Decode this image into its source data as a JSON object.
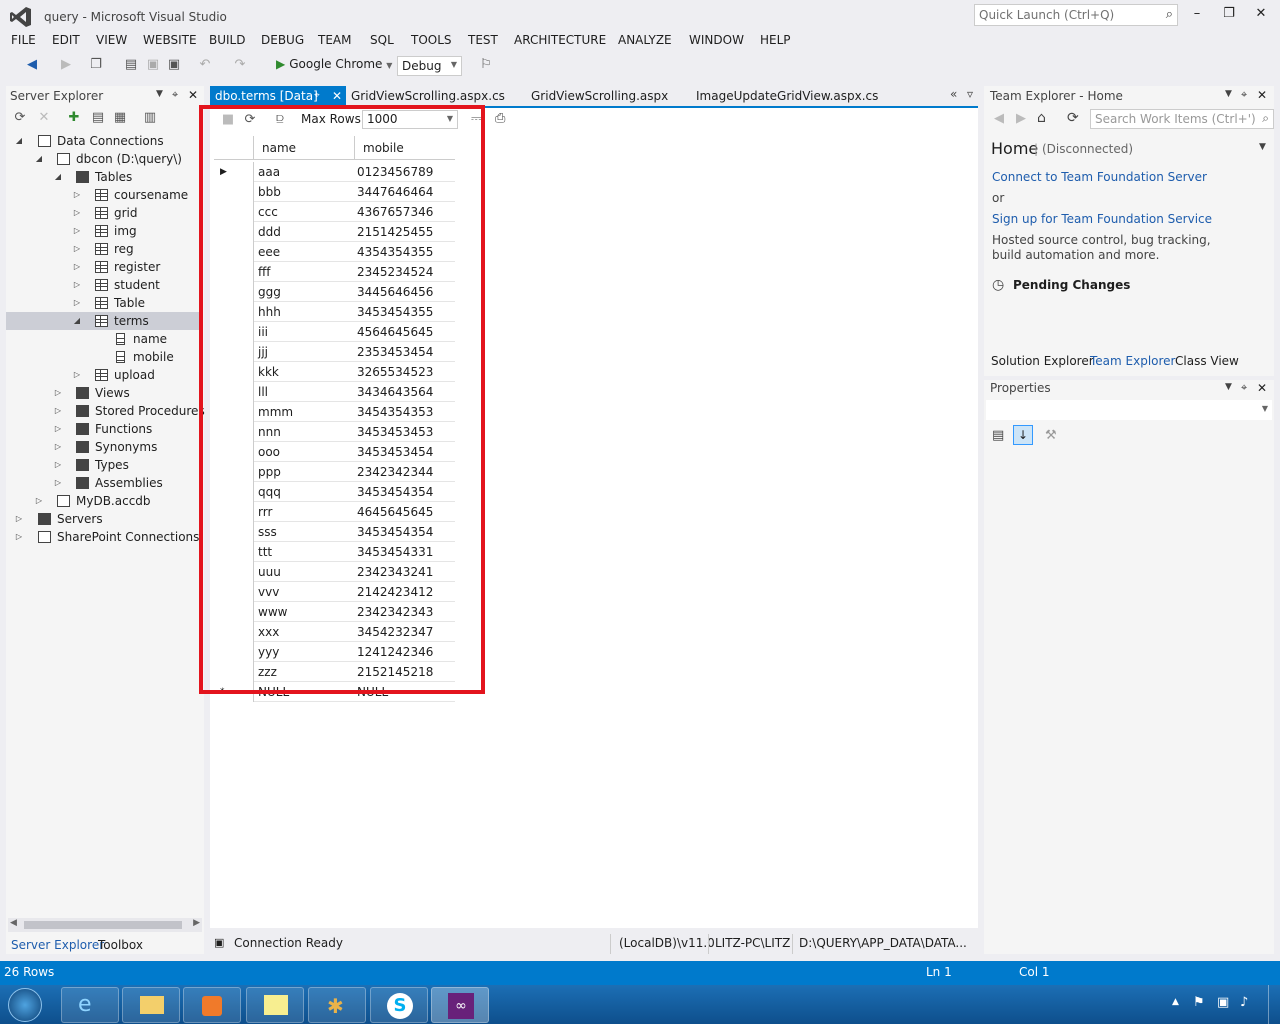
{
  "window": {
    "title": "query - Microsoft Visual Studio",
    "quick_launch_placeholder": "Quick Launch (Ctrl+Q)"
  },
  "menu": [
    "FILE",
    "EDIT",
    "VIEW",
    "WEBSITE",
    "BUILD",
    "DEBUG",
    "TEAM",
    "SQL",
    "TOOLS",
    "TEST",
    "ARCHITECTURE",
    "ANALYZE",
    "WINDOW",
    "HELP"
  ],
  "toolbar": {
    "run_target": "Google Chrome",
    "configuration": "Debug"
  },
  "server_explorer": {
    "title": "Server Explorer",
    "tree": [
      {
        "label": "Data Connections",
        "expanded": true
      },
      {
        "label": "dbcon (D:\\query\\)",
        "expanded": true
      },
      {
        "label": "Tables",
        "expanded": true
      },
      {
        "label": "coursename"
      },
      {
        "label": "grid"
      },
      {
        "label": "img"
      },
      {
        "label": "reg"
      },
      {
        "label": "register"
      },
      {
        "label": "student"
      },
      {
        "label": "Table"
      },
      {
        "label": "terms",
        "expanded": true,
        "selected": true
      },
      {
        "label": "name"
      },
      {
        "label": "mobile"
      },
      {
        "label": "upload"
      },
      {
        "label": "Views"
      },
      {
        "label": "Stored Procedures"
      },
      {
        "label": "Functions"
      },
      {
        "label": "Synonyms"
      },
      {
        "label": "Types"
      },
      {
        "label": "Assemblies"
      },
      {
        "label": "MyDB.accdb"
      },
      {
        "label": "Servers"
      },
      {
        "label": "SharePoint Connections"
      }
    ],
    "bottom_tabs": [
      "Server Explorer",
      "Toolbox"
    ]
  },
  "doc_tabs": [
    "dbo.terms [Data]",
    "GridViewScrolling.aspx.cs",
    "GridViewScrolling.aspx",
    "ImageUpdateGridView.aspx.cs"
  ],
  "grid_toolbar": {
    "max_rows_label": "Max Rows:",
    "max_rows_value": "1000"
  },
  "grid": {
    "columns": [
      "name",
      "mobile"
    ],
    "rows": [
      [
        "aaa",
        "0123456789"
      ],
      [
        "bbb",
        "3447646464"
      ],
      [
        "ccc",
        "4367657346"
      ],
      [
        "ddd",
        "2151425455"
      ],
      [
        "eee",
        "4354354355"
      ],
      [
        "fff",
        "2345234524"
      ],
      [
        "ggg",
        "3445646456"
      ],
      [
        "hhh",
        "3453454355"
      ],
      [
        "iii",
        "4564645645"
      ],
      [
        "jjj",
        "2353453454"
      ],
      [
        "kkk",
        "3265534523"
      ],
      [
        "lll",
        "3434643564"
      ],
      [
        "mmm",
        "3454354353"
      ],
      [
        "nnn",
        "3453453453"
      ],
      [
        "ooo",
        "3453453454"
      ],
      [
        "ppp",
        "2342342344"
      ],
      [
        "qqq",
        "3453454354"
      ],
      [
        "rrr",
        "4645645645"
      ],
      [
        "sss",
        "3453454354"
      ],
      [
        "ttt",
        "3453454331"
      ],
      [
        "uuu",
        "2342343241"
      ],
      [
        "vvv",
        "2142423412"
      ],
      [
        "www",
        "2342342343"
      ],
      [
        "xxx",
        "3454232347"
      ],
      [
        "yyy",
        "1241242346"
      ],
      [
        "zzz",
        "2152145218"
      ]
    ],
    "new_row": [
      "NULL",
      "NULL"
    ]
  },
  "connection_bar": {
    "status": "Connection Ready",
    "server": "(LocalDB)\\v11.0",
    "user": "LITZ-PC\\LITZ",
    "path": "D:\\QUERY\\APP_DATA\\DATA..."
  },
  "team_explorer": {
    "title": "Team Explorer - Home",
    "search_placeholder": "Search Work Items (Ctrl+')",
    "home": "Home",
    "state": "(Disconnected)",
    "connect_link": "Connect to Team Foundation Server",
    "or": "or",
    "signup_link": "Sign up for Team Foundation Service",
    "description": "Hosted source control, bug tracking, build automation and more.",
    "pending": "Pending Changes",
    "tabs": [
      "Solution Explorer",
      "Team Explorer",
      "Class View"
    ]
  },
  "properties": {
    "title": "Properties"
  },
  "statusbar": {
    "rows": "26 Rows",
    "ln": "Ln 1",
    "col": "Col 1"
  },
  "colors": {
    "accent": "#007acc",
    "highlight": "#e3141d"
  }
}
